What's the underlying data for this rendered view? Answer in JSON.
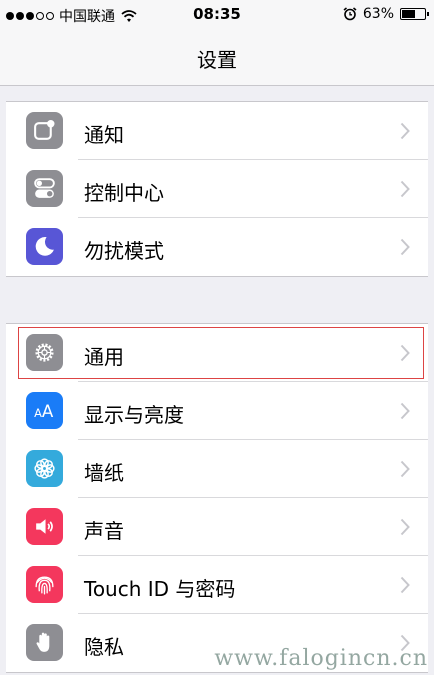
{
  "status_bar": {
    "signal_bars": [
      true,
      true,
      true,
      false,
      false
    ],
    "carrier": "中国联通",
    "time": "08:35",
    "battery_text": "63%",
    "battery_level": 0.63,
    "icons": [
      "wifi-icon",
      "alarm-icon",
      "battery-icon"
    ]
  },
  "nav": {
    "title": "设置"
  },
  "groups": [
    {
      "items": [
        {
          "label": "通知",
          "icon": "notifications-icon",
          "color": "#8e8e93"
        },
        {
          "label": "控制中心",
          "icon": "control-center-icon",
          "color": "#8e8e93"
        },
        {
          "label": "勿扰模式",
          "icon": "do-not-disturb-moon-icon",
          "color": "#5856d6"
        }
      ]
    },
    {
      "items": [
        {
          "label": "通用",
          "icon": "gear-icon",
          "color": "#8e8e93",
          "highlighted": true
        },
        {
          "label": "显示与亮度",
          "icon": "display-brightness-icon",
          "color": "#1a7cf7"
        },
        {
          "label": "墙纸",
          "icon": "wallpaper-flower-icon",
          "color": "#34aadc"
        },
        {
          "label": "声音",
          "icon": "sounds-speaker-icon",
          "color": "#f4375d"
        },
        {
          "label": "Touch ID 与密码",
          "icon": "fingerprint-icon",
          "color": "#f4375d"
        },
        {
          "label": "隐私",
          "icon": "privacy-hand-icon",
          "color": "#8e8e93"
        }
      ]
    }
  ],
  "watermark": "www.falogincn.cn"
}
